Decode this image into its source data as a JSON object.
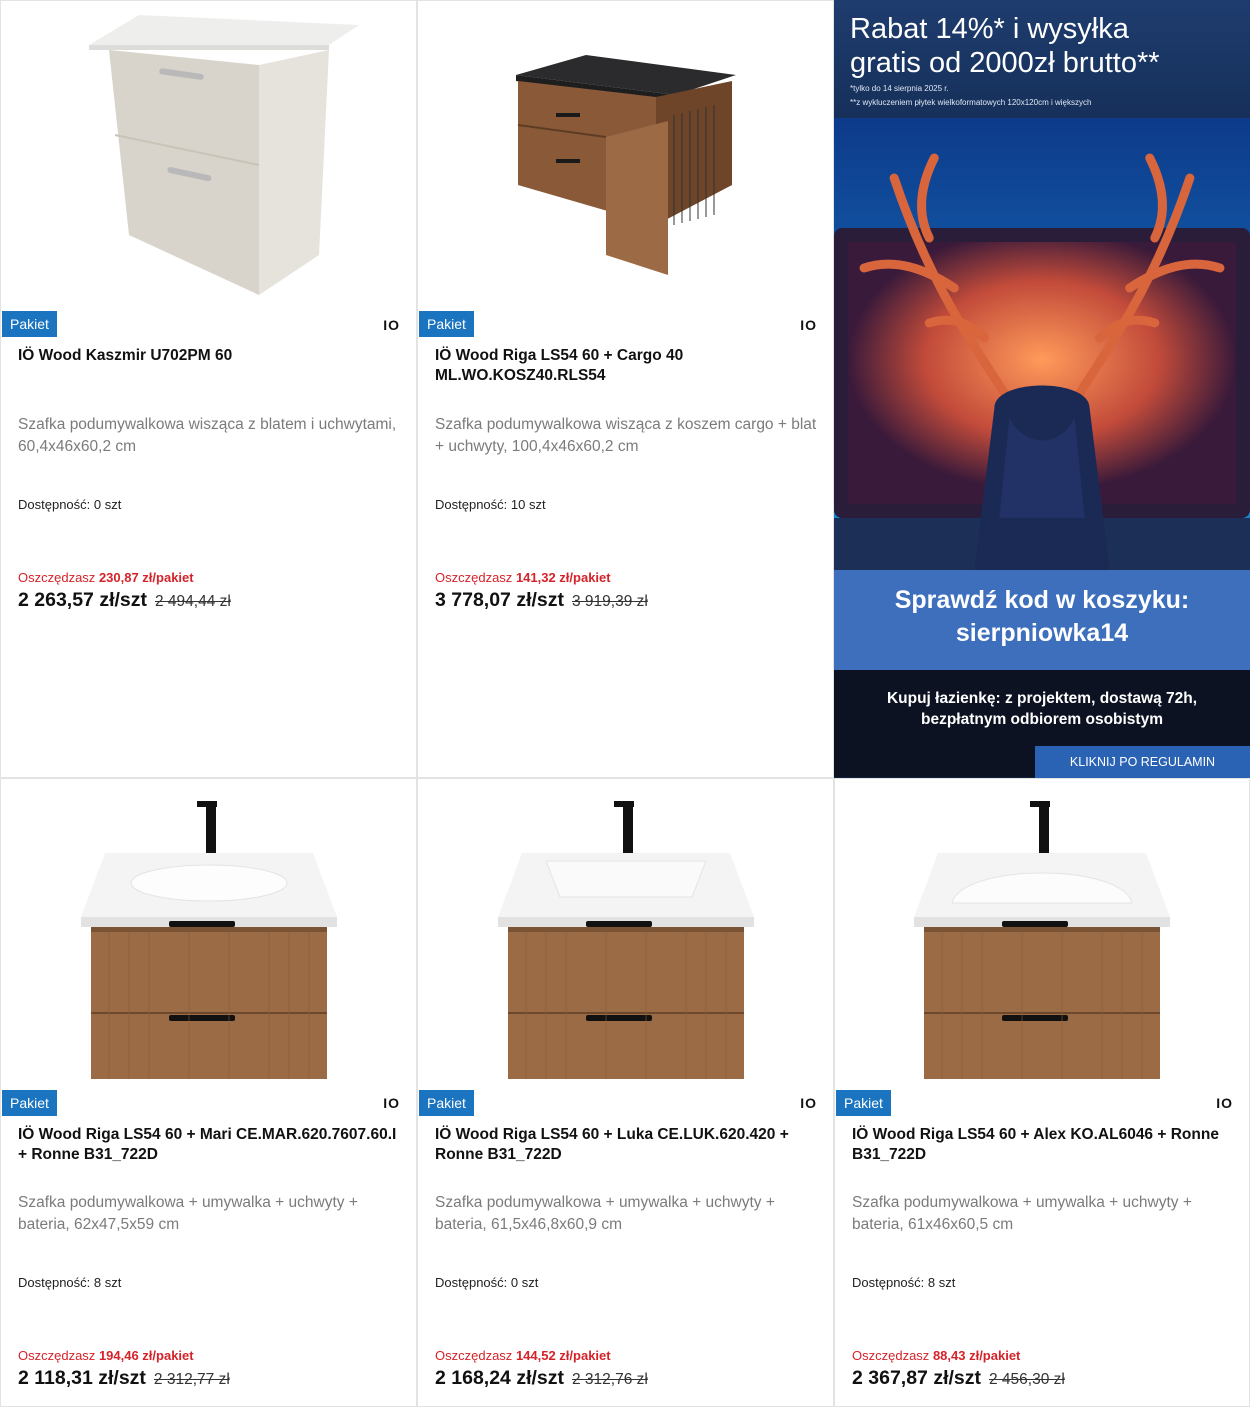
{
  "products": [
    {
      "badge": "Pakiet",
      "brand": "IO",
      "title": "IÖ Wood Kaszmir U702PM 60",
      "description": "Szafka podumywalkowa wisząca z blatem i uchwytami, 60,4x46x60,2 cm",
      "availability_label": "Dostępność:",
      "availability_value": "0 szt",
      "save_label": "Oszczędzasz",
      "save_value": "230,87 zł/pakiet",
      "price": "2 263,57 zł/szt",
      "old_price": "2 494,44 zł",
      "image": "cabinet-kaszmir-icon"
    },
    {
      "badge": "Pakiet",
      "brand": "IO",
      "title": "IÖ Wood Riga LS54 60 + Cargo 40 ML.WO.KOSZ40.RLS54",
      "description": "Szafka podumywalkowa wisząca z koszem cargo + blat + uchwyty, 100,4x46x60,2 cm",
      "availability_label": "Dostępność:",
      "availability_value": "10 szt",
      "save_label": "Oszczędzasz",
      "save_value": "141,32 zł/pakiet",
      "price": "3 778,07 zł/szt",
      "old_price": "3 919,39 zł",
      "image": "cabinet-cargo-icon"
    },
    {
      "badge": "Pakiet",
      "brand": "IO",
      "title": "IÖ Wood Riga LS54 60 + Mari CE.MAR.620.7607.60.I + Ronne B31_722D",
      "description": "Szafka podumywalkowa + umywalka + uchwyty + bateria, 62x47,5x59 cm",
      "availability_label": "Dostępność:",
      "availability_value": "8 szt",
      "save_label": "Oszczędzasz",
      "save_value": "194,46 zł/pakiet",
      "price": "2 118,31 zł/szt",
      "old_price": "2 312,77 zł",
      "image": "vanity-sink-icon"
    },
    {
      "badge": "Pakiet",
      "brand": "IO",
      "title": "IÖ Wood Riga LS54 60 + Luka CE.LUK.620.420 + Ronne B31_722D",
      "description": "Szafka podumywalkowa + umywalka + uchwyty + bateria, 61,5x46,8x60,9 cm",
      "availability_label": "Dostępność:",
      "availability_value": "0 szt",
      "save_label": "Oszczędzasz",
      "save_value": "144,52 zł/pakiet",
      "price": "2 168,24 zł/szt",
      "old_price": "2 312,76 zł",
      "image": "vanity-sink-icon"
    },
    {
      "badge": "Pakiet",
      "brand": "IO",
      "title": "IÖ Wood Riga LS54 60 + Alex KO.AL6046 + Ronne B31_722D",
      "description": "Szafka podumywalkowa + umywalka + uchwyty + bateria, 61x46x60,5 cm",
      "availability_label": "Dostępność:",
      "availability_value": "8 szt",
      "save_label": "Oszczędzasz",
      "save_value": "88,43 zł/pakiet",
      "price": "2 367,87 zł/szt",
      "old_price": "2 456,30 zł",
      "image": "vanity-sink-icon"
    }
  ],
  "banner": {
    "headline_line1": "Rabat 14%* i wysyłka",
    "headline_line2": "gratis od 2000zł brutto**",
    "note1": "*tylko do 14 sierpnia 2025 r.",
    "note2": "**z wykluczeniem płytek wielkoformatowych 120x120cm i większych",
    "code_line1": "Sprawdź kod w koszyku:",
    "code_line2": "sierpniowka14",
    "tagline_line1": "Kupuj łazienkę: z projektem, dostawą 72h,",
    "tagline_line2": "bezpłatnym odbiorem osobistym",
    "cta": "KLIKNIJ PO REGULAMIN",
    "image": "deer-monitor-icon"
  },
  "colors": {
    "badge": "#1a74bf",
    "save": "#d5232a",
    "banner_blue": "#3d6fbd"
  }
}
